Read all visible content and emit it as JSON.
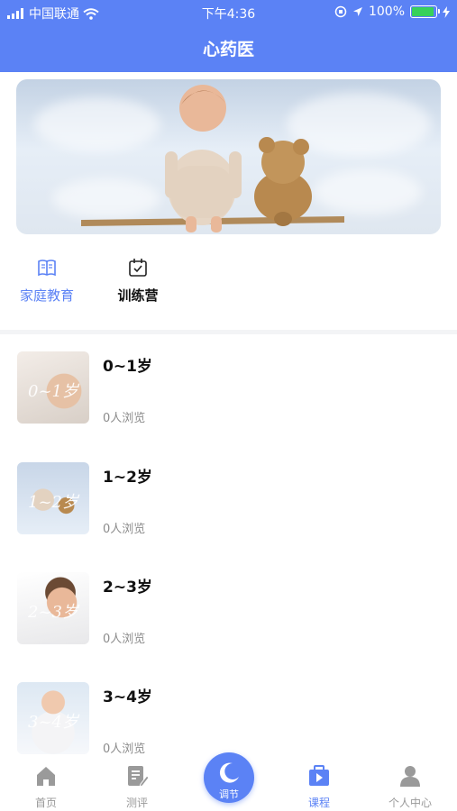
{
  "status_bar": {
    "carrier": "中国联通",
    "time": "下午4:36",
    "battery": "100%"
  },
  "header": {
    "title": "心药医"
  },
  "colors": {
    "accent": "#5b82f5",
    "battery": "#37d15a",
    "muted": "#999999"
  },
  "category_tabs": [
    {
      "label": "家庭教育",
      "icon": "book-icon",
      "active": true
    },
    {
      "label": "训练营",
      "icon": "calendar-check-icon",
      "active": false
    }
  ],
  "courses": [
    {
      "age": "0~1岁",
      "views": "0人浏览",
      "thumb_caption": "0~1岁"
    },
    {
      "age": "1~2岁",
      "views": "0人浏览",
      "thumb_caption": "1~2岁"
    },
    {
      "age": "2~3岁",
      "views": "0人浏览",
      "thumb_caption": "2~3岁"
    },
    {
      "age": "3~4岁",
      "views": "0人浏览",
      "thumb_caption": "3~4岁"
    }
  ],
  "tabbar": [
    {
      "label": "首页",
      "icon": "home-icon",
      "active": false
    },
    {
      "label": "测评",
      "icon": "edit-note-icon",
      "active": false
    },
    {
      "label": "调节",
      "icon": "moon-icon",
      "active": false,
      "center": true
    },
    {
      "label": "课程",
      "icon": "course-video-icon",
      "active": true
    },
    {
      "label": "个人中心",
      "icon": "user-icon",
      "active": false
    }
  ]
}
